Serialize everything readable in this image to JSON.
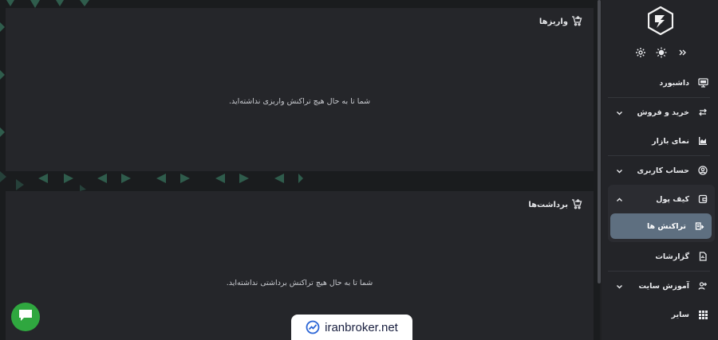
{
  "deposits": {
    "title": "واریزها",
    "empty_message": "شما تا به حال هیچ تراکنش واریزی نداشته‌اید."
  },
  "withdrawals": {
    "title": "برداشت‌ها",
    "empty_message": "شما تا به حال هیچ تراکنش برداشتی نداشته‌اید."
  },
  "sidebar": {
    "items": [
      {
        "label": "داشبورد",
        "icon": "monitor-icon"
      },
      {
        "label": "خرید و فروش",
        "icon": "exchange-icon"
      },
      {
        "label": "نمای بازار",
        "icon": "market-chart-icon"
      },
      {
        "label": "حساب کاربری",
        "icon": "user-circle-icon"
      },
      {
        "label": "کیف پول",
        "icon": "wallet-icon"
      },
      {
        "label": "تراکنش ها",
        "icon": "transactions-icon"
      },
      {
        "label": "گزارشات",
        "icon": "report-icon"
      },
      {
        "label": "آموزش سایت",
        "icon": "user-edu-icon"
      },
      {
        "label": "سایر",
        "icon": "grid-icon"
      }
    ]
  },
  "watermark": {
    "text": "iranbroker.net"
  },
  "colors": {
    "accent": "#5e6f80",
    "chat": "#2fa73f",
    "pattern": "#2e5a4a"
  }
}
